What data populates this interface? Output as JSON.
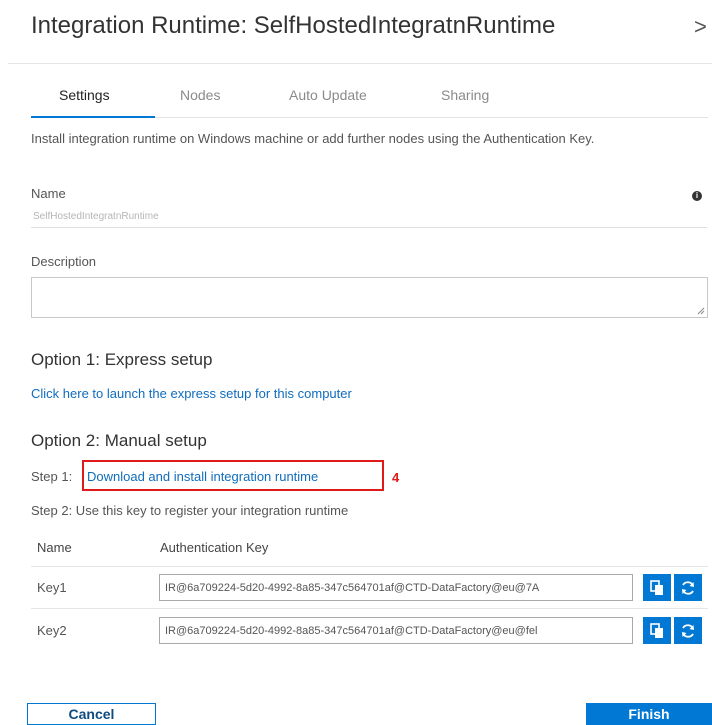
{
  "header": {
    "title": "Integration Runtime: SelfHostedIntegratnRuntime",
    "close_glyph": ">"
  },
  "tabs": [
    {
      "label": "Settings",
      "active": true
    },
    {
      "label": "Nodes",
      "active": false
    },
    {
      "label": "Auto Update",
      "active": false
    },
    {
      "label": "Sharing",
      "active": false
    }
  ],
  "settings": {
    "intro": "Install integration runtime on Windows machine or add further nodes using the Authentication Key.",
    "name_label": "Name",
    "name_value": "SelfHostedIntegratnRuntime",
    "description_label": "Description",
    "description_value": ""
  },
  "option1": {
    "heading": "Option 1: Express setup",
    "link": "Click here to launch the express setup for this computer"
  },
  "option2": {
    "heading": "Option 2: Manual setup",
    "step1_prefix": "Step 1:",
    "step1_link": "Download and install integration runtime",
    "annotation": "4",
    "step2": "Step 2: Use this key to register your integration runtime"
  },
  "keys_table": {
    "headers": [
      "Name",
      "Authentication Key"
    ],
    "rows": [
      {
        "name": "Key1",
        "value": "IR@6a709224-5d20-4992-8a85-347c564701af@CTD-DataFactory@eu@7A"
      },
      {
        "name": "Key2",
        "value": "IR@6a709224-5d20-4992-8a85-347c564701af@CTD-DataFactory@eu@fel"
      }
    ]
  },
  "footer": {
    "cancel_label": "Cancel",
    "finish_label": "Finish"
  },
  "colors": {
    "accent": "#0078d4",
    "link": "#0f6cbd",
    "highlight": "#e01919"
  }
}
